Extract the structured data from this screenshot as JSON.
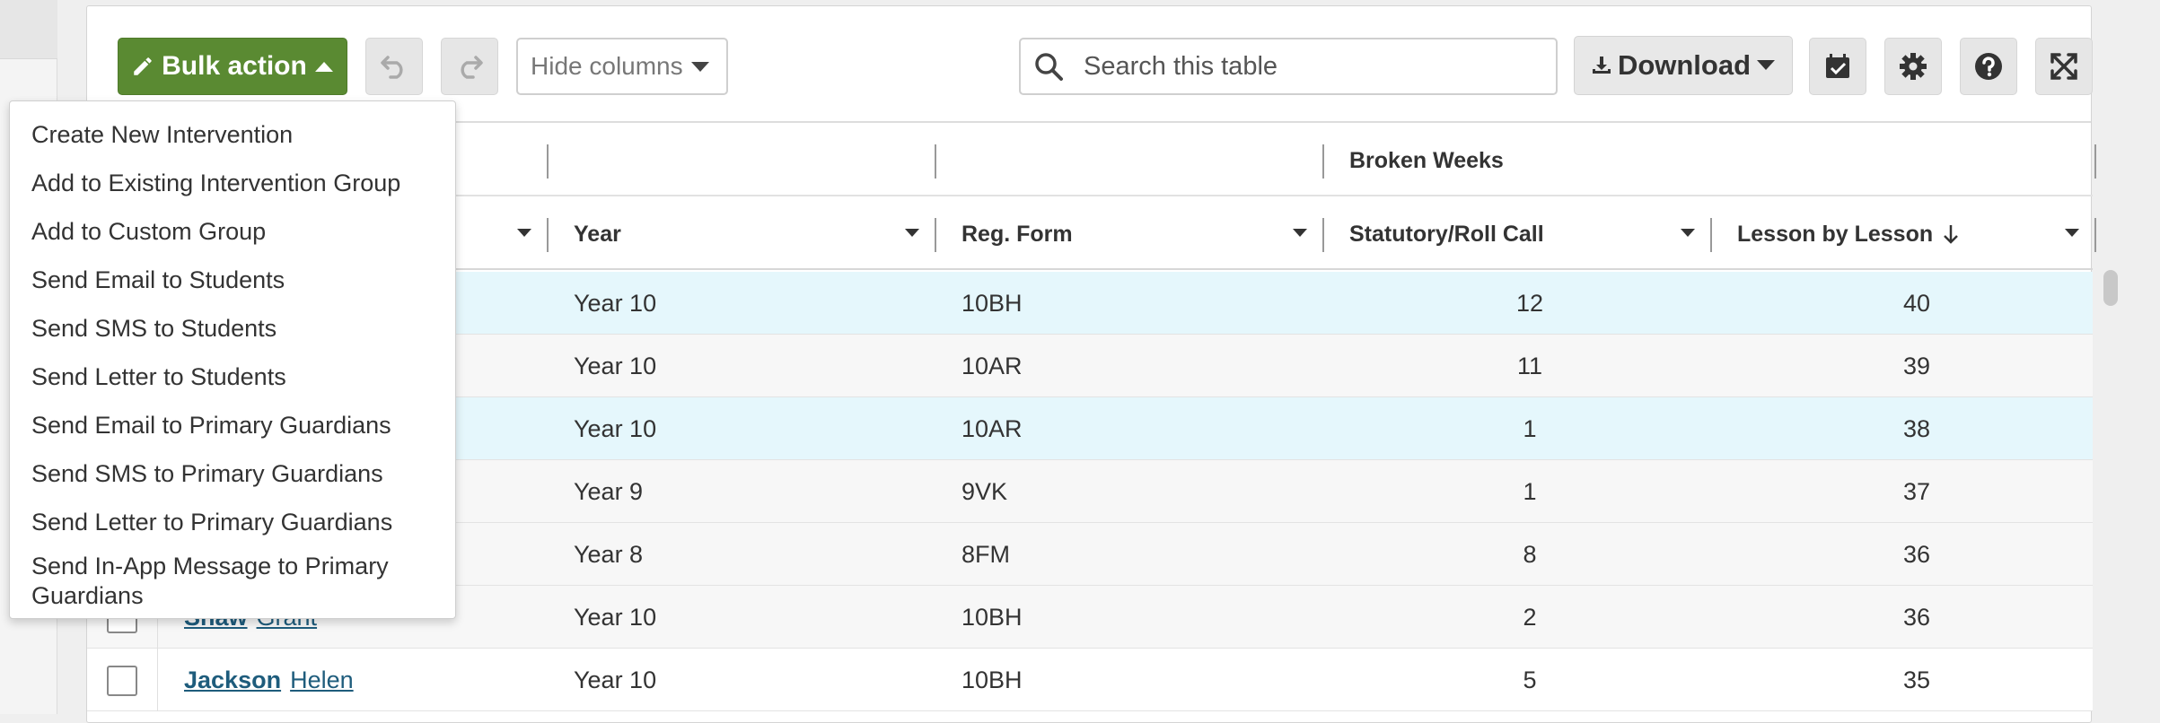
{
  "toolbar": {
    "bulk_action_label": "Bulk action",
    "hide_columns_placeholder": "Hide columns",
    "search_placeholder": "Search this table",
    "download_label": "Download"
  },
  "bulk_menu": {
    "items": [
      "Create New Intervention",
      "Add to Existing Intervention Group",
      "Add to Custom Group",
      "Send Email to Students",
      "Send SMS to Students",
      "Send Letter to Students",
      "Send Email to Primary Guardians",
      "Send SMS to Primary Guardians",
      "Send Letter to Primary Guardians",
      "Send In-App Message to Primary Guardians"
    ]
  },
  "table": {
    "group_header": "Broken Weeks",
    "columns": {
      "year": "Year",
      "reg_form": "Reg. Form",
      "statutory": "Statutory/Roll Call",
      "lesson": "Lesson by Lesson"
    },
    "rows": [
      {
        "surname": "",
        "forename": "",
        "year": "Year 10",
        "reg": "10BH",
        "statutory": "12",
        "lesson": "40",
        "selected": true
      },
      {
        "surname": "",
        "forename": "",
        "year": "Year 10",
        "reg": "10AR",
        "statutory": "11",
        "lesson": "39",
        "selected": false
      },
      {
        "surname": "",
        "forename": "",
        "year": "Year 10",
        "reg": "10AR",
        "statutory": "1",
        "lesson": "38",
        "selected": true
      },
      {
        "surname": "",
        "forename": "",
        "year": "Year 9",
        "reg": "9VK",
        "statutory": "1",
        "lesson": "37",
        "selected": false
      },
      {
        "surname": "",
        "forename": "",
        "year": "Year 8",
        "reg": "8FM",
        "statutory": "8",
        "lesson": "36",
        "selected": false
      },
      {
        "surname": "Shaw",
        "forename": "Grant",
        "year": "Year 10",
        "reg": "10BH",
        "statutory": "2",
        "lesson": "36",
        "selected": false
      },
      {
        "surname": "Jackson",
        "forename": "Helen",
        "year": "Year 10",
        "reg": "10BH",
        "statutory": "5",
        "lesson": "35",
        "selected": false
      }
    ]
  },
  "colors": {
    "bulk_button": "#5a8a32",
    "selected_row": "#e5f7fc",
    "link": "#1e5c7c"
  }
}
